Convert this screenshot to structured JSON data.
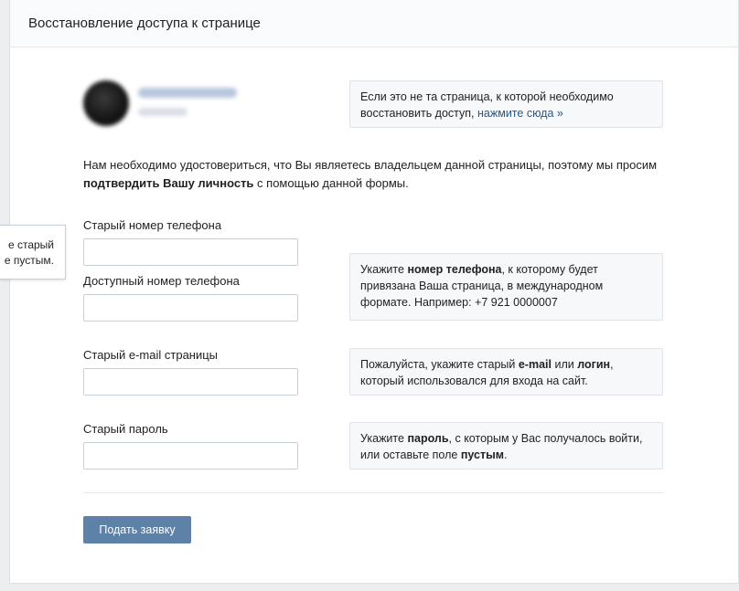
{
  "header": {
    "title": "Восстановление доступа к странице"
  },
  "profile": {
    "wrong_page_note": {
      "text": "Если это не та страница, к которой необходимо восстановить доступ,",
      "link": "нажмите сюда »"
    }
  },
  "intro": {
    "part1": "Нам необходимо удостовериться, что Вы являетесь владельцем данной страницы, поэтому мы просим ",
    "bold": "подтвердить Вашу личность",
    "part2": " с помощью данной формы."
  },
  "tooltip": {
    "line1": "е старый",
    "line2": "е пустым."
  },
  "form": {
    "old_phone_label": "Старый номер телефона",
    "old_phone_value": "",
    "available_phone_label": "Доступный номер телефона",
    "available_phone_value": "",
    "old_email_label": "Старый e-mail страницы",
    "old_email_value": "",
    "old_password_label": "Старый пароль",
    "old_password_value": ""
  },
  "hints": {
    "phone": {
      "part1": "Укажите ",
      "bold": "номер телефона",
      "part2": ", к которому будет привязана Ваша страница, в международном формате. Например: +7 921 0000007"
    },
    "email": {
      "part1": "Пожалуйста, укажите старый ",
      "bold1": "e-mail",
      "part2": " или ",
      "bold2": "логин",
      "part3": ", который использовался для входа на сайт."
    },
    "password": {
      "part1": "Укажите ",
      "bold1": "пароль",
      "part2": ", с которым у Вас получалось войти, или оставьте поле ",
      "bold2": "пустым",
      "part3": "."
    }
  },
  "submit_label": "Подать заявку",
  "colors": {
    "accent": "#5e81a8",
    "link": "#2a5885",
    "background": "#edeef0"
  }
}
